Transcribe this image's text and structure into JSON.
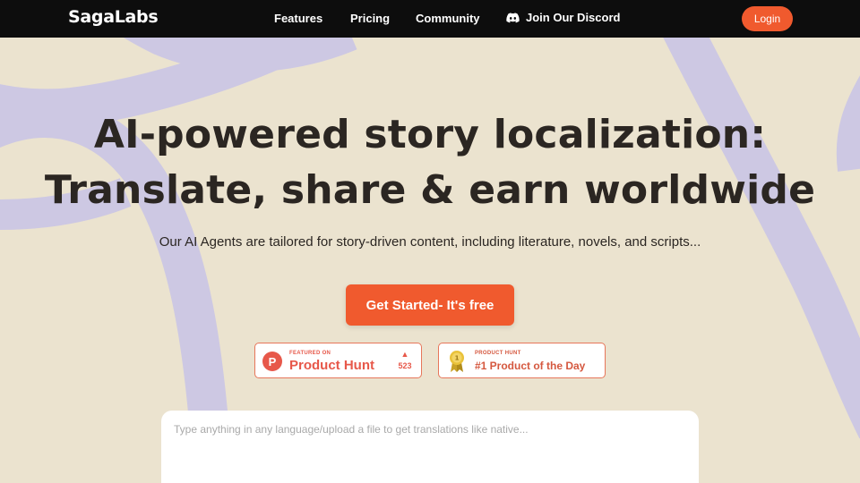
{
  "brand": {
    "logo": "SagaLabs"
  },
  "nav": {
    "features": "Features",
    "pricing": "Pricing",
    "community": "Community",
    "discord": "Join Our Discord",
    "discord_icon": "discord-icon",
    "login": "Login"
  },
  "hero": {
    "title_line1": "AI-powered story localization:",
    "title_line2": "Translate, share & earn worldwide",
    "subtitle": "Our AI Agents are tailored for story-driven content, including literature, novels, and scripts...",
    "cta": "Get Started- It's free"
  },
  "badges": {
    "product_hunt": {
      "small": "FEATURED ON",
      "big": "Product Hunt",
      "letter": "P",
      "upvotes": "523",
      "icon": "upvote-arrow-icon"
    },
    "day": {
      "small": "PRODUCT HUNT",
      "big": "#1 Product of the Day",
      "icon": "medal-icon"
    }
  },
  "input": {
    "placeholder": "Type anything in any language/upload a file to get translations like native..."
  },
  "colors": {
    "accent": "#f05a2e",
    "background": "#ebe3cf",
    "nav": "#0d0d0d",
    "swirl": "#cdc8e3",
    "product_hunt": "#e7584a"
  }
}
